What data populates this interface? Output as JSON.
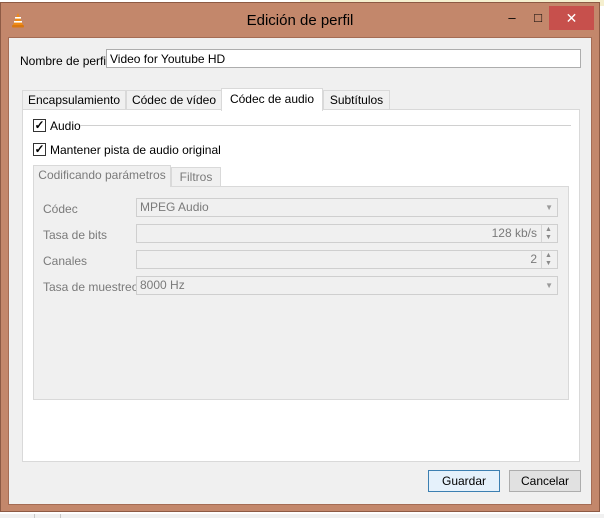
{
  "window": {
    "title": "Edición de perfil",
    "app_icon": "vlc-cone-icon",
    "controls": {
      "minimize": "–",
      "maximize": "□",
      "close": "✕"
    }
  },
  "profile": {
    "name_label": "Nombre de perfil",
    "name_value": "Video for Youtube HD"
  },
  "tabs": [
    {
      "label": "Encapsulamiento",
      "active": false
    },
    {
      "label": "Códec de vídeo",
      "active": false
    },
    {
      "label": "Códec de audio",
      "active": true
    },
    {
      "label": "Subtítulos",
      "active": false
    }
  ],
  "audio": {
    "audio_checkbox_label": "Audio",
    "audio_checked": true,
    "keep_original_label": "Mantener pista de audio original",
    "keep_original_checked": true
  },
  "inner_tabs": [
    {
      "label": "Codificando parámetros",
      "active": true
    },
    {
      "label": "Filtros",
      "active": false
    }
  ],
  "params": {
    "codec_label": "Códec",
    "codec_value": "MPEG Audio",
    "bitrate_label": "Tasa de bits",
    "bitrate_value": "128 kb/s",
    "channels_label": "Canales",
    "channels_value": "2",
    "samplerate_label": "Tasa de muestreo",
    "samplerate_value": "8000 Hz"
  },
  "buttons": {
    "save": "Guardar",
    "cancel": "Cancelar"
  },
  "colors": {
    "window_frame": "#c3876b",
    "close_button": "#c7504c",
    "dialog_bg": "#f0f0f0",
    "default_button_border": "#3c7fb1"
  }
}
